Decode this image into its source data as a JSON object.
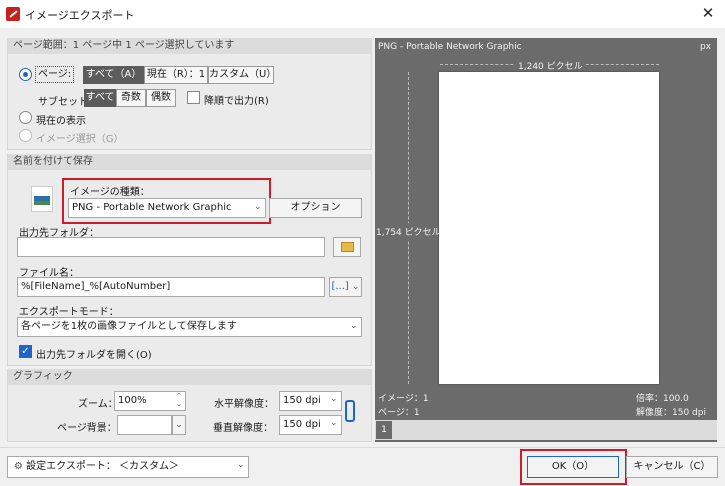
{
  "window": {
    "title": "イメージエクスポート",
    "close_glyph": "✕"
  },
  "page_range": {
    "header": "ページ範囲：1 ページ中 1 ページ選択しています",
    "pages_radio_label": "ページ:",
    "scope_buttons": [
      "すべて（A）",
      "現在（R）：1",
      "カスタム（U）"
    ],
    "subset_label": "サブセット:",
    "subset_buttons": [
      "すべて",
      "奇数",
      "偶数"
    ],
    "reverse_label": "降順で出力(R)",
    "current_view_label": "現在の表示",
    "selection_label": "イメージ選択（G）"
  },
  "save_as": {
    "header": "名前を付けて保存",
    "image_type_label": "イメージの種類：",
    "image_type_value": "PNG - Portable Network Graphic",
    "options_button": "オプション",
    "output_folder_label": "出力先フォルダ：",
    "output_folder_value": "",
    "file_name_label": "ファイル名：",
    "file_name_value": "%[FileName]_%[AutoNumber]",
    "file_name_macro": "[...]",
    "export_mode_label": "エクスポートモード：",
    "export_mode_value": "各ページを1枚の画像ファイルとして保存します",
    "open_folder_label": "出力先フォルダを開く(O)",
    "open_folder_checked": true
  },
  "graphics": {
    "header": "グラフィック",
    "zoom_label": "ズーム：",
    "zoom_value": "100%",
    "page_bg_label": "ページ背景：",
    "h_res_label": "水平解像度：",
    "h_res_value": "150 dpi",
    "v_res_label": "垂直解像度：",
    "v_res_value": "150 dpi"
  },
  "preview": {
    "format": "PNG - Portable Network Graphic",
    "unit": "px",
    "width_label": "1,240 ピクセル",
    "height_label": "1,754 ピクセル",
    "image_label": "イメージ：1",
    "page_label": "ページ：1",
    "scale_label": "倍率：100.0",
    "resolution_label": "解像度：150 dpi",
    "page_number": "1"
  },
  "footer": {
    "preset_label": "設定エクスポート：",
    "preset_value": "＜カスタム＞",
    "ok_button": "OK（O）",
    "cancel_button": "キャンセル（C）"
  },
  "colors": {
    "accent": "#1e66c8",
    "highlight_border": "#d21a2a",
    "preview_bg": "#6b6b6b"
  }
}
